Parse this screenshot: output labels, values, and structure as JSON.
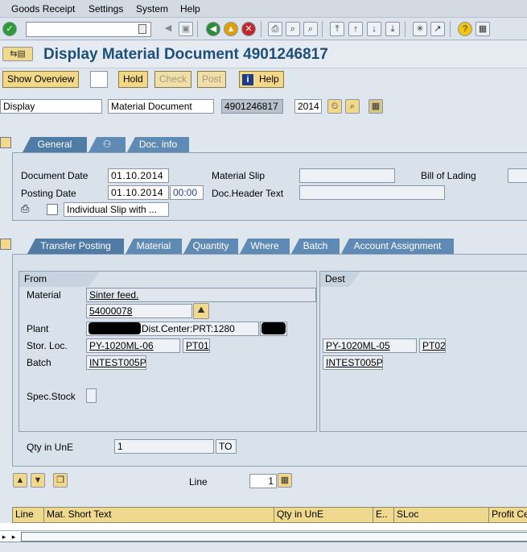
{
  "menu": {
    "goods_receipt": "Goods Receipt",
    "settings": "Settings",
    "system": "System",
    "help": "Help"
  },
  "title": "Display Material Document 4901246817",
  "toolbar2": {
    "show_overview": "Show Overview",
    "hold": "Hold",
    "check": "Check",
    "post": "Post",
    "help": "Help"
  },
  "header_row": {
    "action": "Display",
    "ref": "Material Document",
    "doc_number": "4901246817",
    "year": "2014"
  },
  "top_tabs": {
    "general": "General",
    "doc_info": "Doc. info"
  },
  "general": {
    "document_date_label": "Document Date",
    "document_date": "01.10.2014",
    "posting_date_label": "Posting Date",
    "posting_date": "01.10.2014",
    "posting_time": "00:00",
    "material_slip_label": "Material Slip",
    "doc_header_text_label": "Doc.Header Text",
    "bill_of_lading_label": "Bill of Lading",
    "print_option": "Individual Slip with ..."
  },
  "item_tabs": [
    "Transfer Posting",
    "Material",
    "Quantity",
    "Where",
    "Batch",
    "Account Assignment"
  ],
  "from": {
    "header": "From",
    "material_label": "Material",
    "material_desc": "Sinter feed.",
    "material_number": "54000078",
    "plant_label": "Plant",
    "plant_text": "Dist.Center:PRT:1280",
    "stor_loc_label": "Stor. Loc.",
    "stor_loc": "PY-1020ML-06",
    "stor_loc_code": "PT01",
    "batch_label": "Batch",
    "batch": "INTEST005P",
    "spec_stock_label": "Spec.Stock"
  },
  "dest": {
    "header": "Dest",
    "stor_loc": "PY-1020ML-05",
    "stor_loc_code": "PT02",
    "batch": "INTEST005P"
  },
  "qty": {
    "label": "Qty in UnE",
    "value": "1",
    "unit": "TO"
  },
  "line": {
    "label": "Line",
    "value": "1"
  },
  "grid_columns": [
    "Line",
    "Mat. Short Text",
    "Qty in UnE",
    "E..",
    "SLoc",
    "Profit Ce"
  ]
}
